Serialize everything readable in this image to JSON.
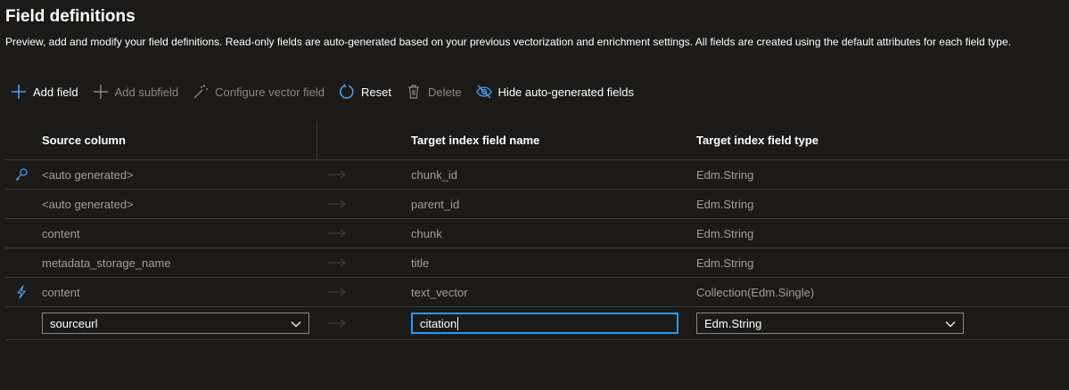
{
  "header": {
    "title": "Field definitions",
    "description": "Preview, add and modify your field definitions. Read-only fields are auto-generated based on your previous vectorization and enrichment settings. All fields are created using the default attributes for each field type."
  },
  "toolbar": {
    "add_field": "Add field",
    "add_subfield": "Add subfield",
    "configure_vector_field": "Configure vector field",
    "reset": "Reset",
    "delete": "Delete",
    "hide_auto_generated": "Hide auto-generated fields"
  },
  "table": {
    "columns": {
      "source": "Source column",
      "name": "Target index field name",
      "type": "Target index field type"
    },
    "rows": [
      {
        "icon": "key-icon",
        "source": "<auto generated>",
        "name": "chunk_id",
        "type": "Edm.String"
      },
      {
        "icon": "",
        "source": "<auto generated>",
        "name": "parent_id",
        "type": "Edm.String"
      },
      {
        "icon": "",
        "source": "content",
        "name": "chunk",
        "type": "Edm.String"
      },
      {
        "icon": "",
        "source": "metadata_storage_name",
        "name": "title",
        "type": "Edm.String"
      },
      {
        "icon": "lightning-icon",
        "source": "content",
        "name": "text_vector",
        "type": "Collection(Edm.Single)"
      }
    ],
    "edit_row": {
      "source_selected": "sourceurl",
      "name_value": "citation",
      "type_selected": "Edm.String"
    }
  },
  "colors": {
    "accent": "#2899f5",
    "background": "#1b1a19",
    "muted_text": "#a19f9d",
    "disabled_text": "#8a8886"
  }
}
